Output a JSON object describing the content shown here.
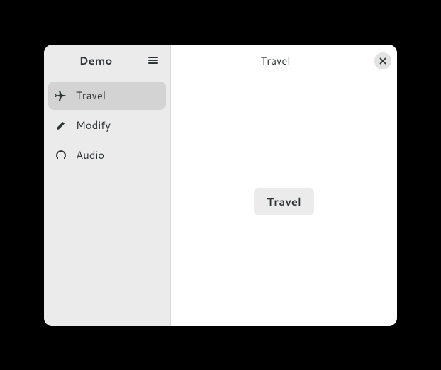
{
  "sidebar": {
    "title": "Demo",
    "items": [
      {
        "label": "Travel",
        "icon": "airplane-icon",
        "selected": true
      },
      {
        "label": "Modify",
        "icon": "pencil-icon",
        "selected": false
      },
      {
        "label": "Audio",
        "icon": "headphones-icon",
        "selected": false
      }
    ]
  },
  "content": {
    "title": "Travel",
    "button_label": "Travel"
  }
}
